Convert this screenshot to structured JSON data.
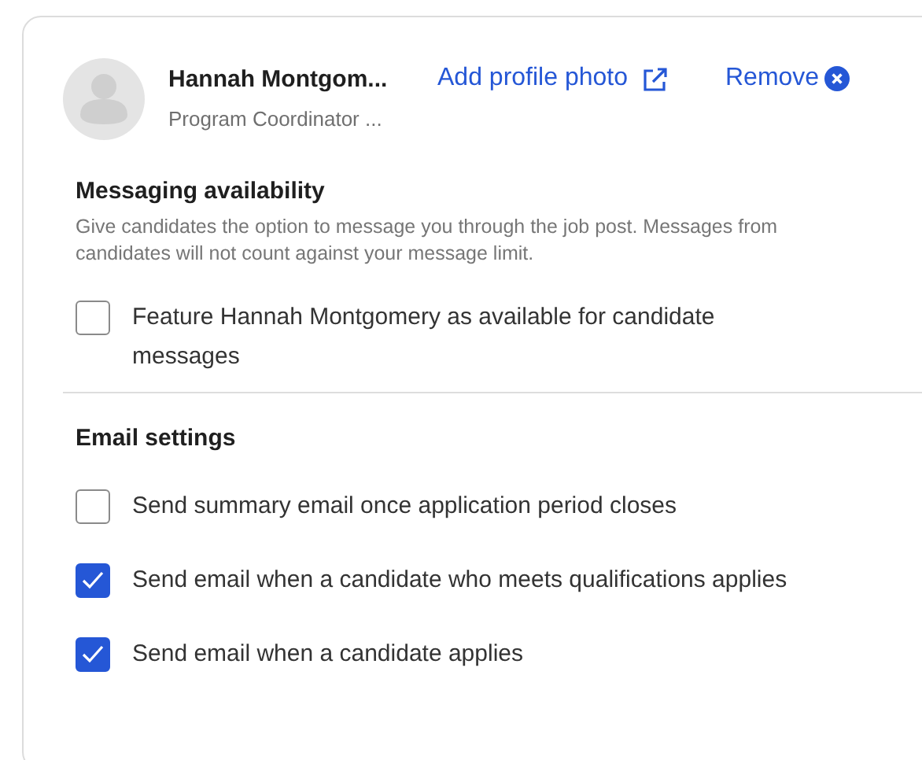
{
  "profile": {
    "name": "Hannah Montgom...",
    "title": "Program Coordinator ...",
    "add_photo_link": "Add profile photo",
    "remove_link": "Remove"
  },
  "messaging": {
    "heading": "Messaging availability",
    "description": "Give candidates the option to message you through the job post. Messages from candidates will not count against your message limit.",
    "options": [
      {
        "label": "Feature Hannah Montgomery as available for candidate messages",
        "checked": false
      }
    ]
  },
  "email": {
    "heading": "Email settings",
    "options": [
      {
        "label": "Send summary email once application period closes",
        "checked": false
      },
      {
        "label": "Send email when a candidate who meets qualifications applies",
        "checked": true
      },
      {
        "label": "Send email when a candidate applies",
        "checked": true
      }
    ]
  }
}
